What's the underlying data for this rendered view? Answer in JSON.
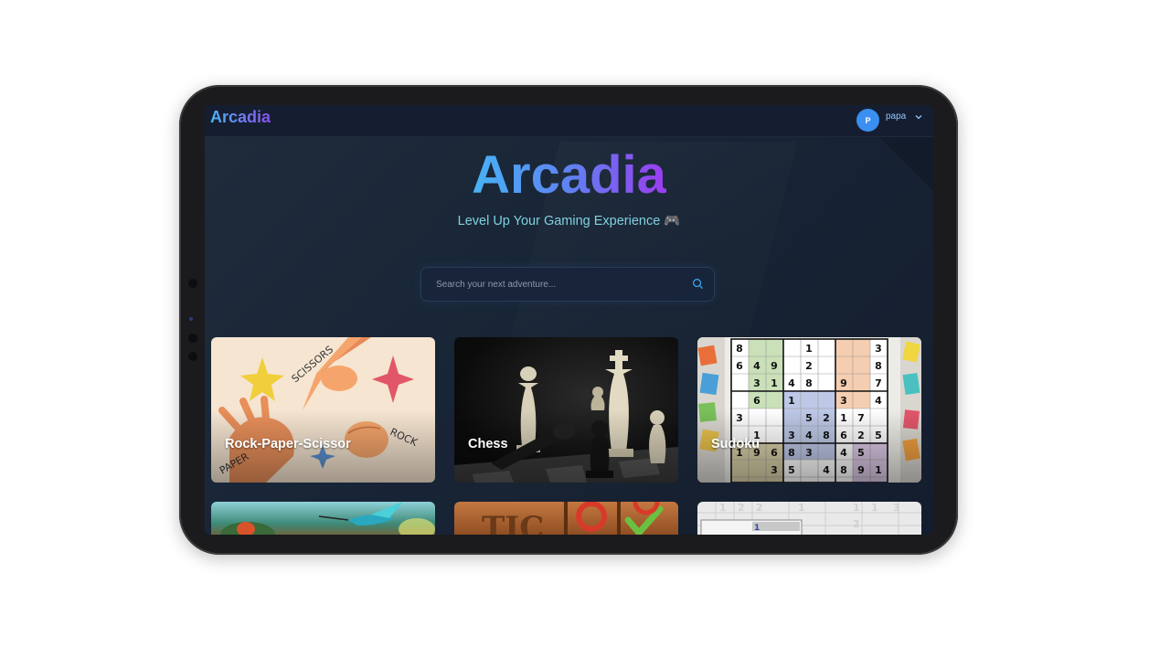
{
  "navbar": {
    "brand": "Arcadia",
    "user": {
      "initial": "P",
      "name": "papa"
    }
  },
  "hero": {
    "title": "Arcadia",
    "tagline": "Level Up Your Gaming Experience 🎮"
  },
  "search": {
    "placeholder": "Search your next adventure..."
  },
  "games": [
    {
      "title": "Rock-Paper-Scissor",
      "art": "rock-paper-scissors-hands"
    },
    {
      "title": "Chess",
      "art": "chess-pieces"
    },
    {
      "title": "Sudoku",
      "art": "sudoku-grid"
    },
    {
      "title": "",
      "art": "hummingbird"
    },
    {
      "title": "",
      "art": "tic-tac-toe-board"
    },
    {
      "title": "",
      "art": "minesweeper-grid"
    }
  ],
  "colors": {
    "brand_gradient_start": "#47b3f5",
    "brand_gradient_end": "#9b3cf0",
    "tagline": "#7fd1e0",
    "avatar": "#3a8ff0"
  }
}
